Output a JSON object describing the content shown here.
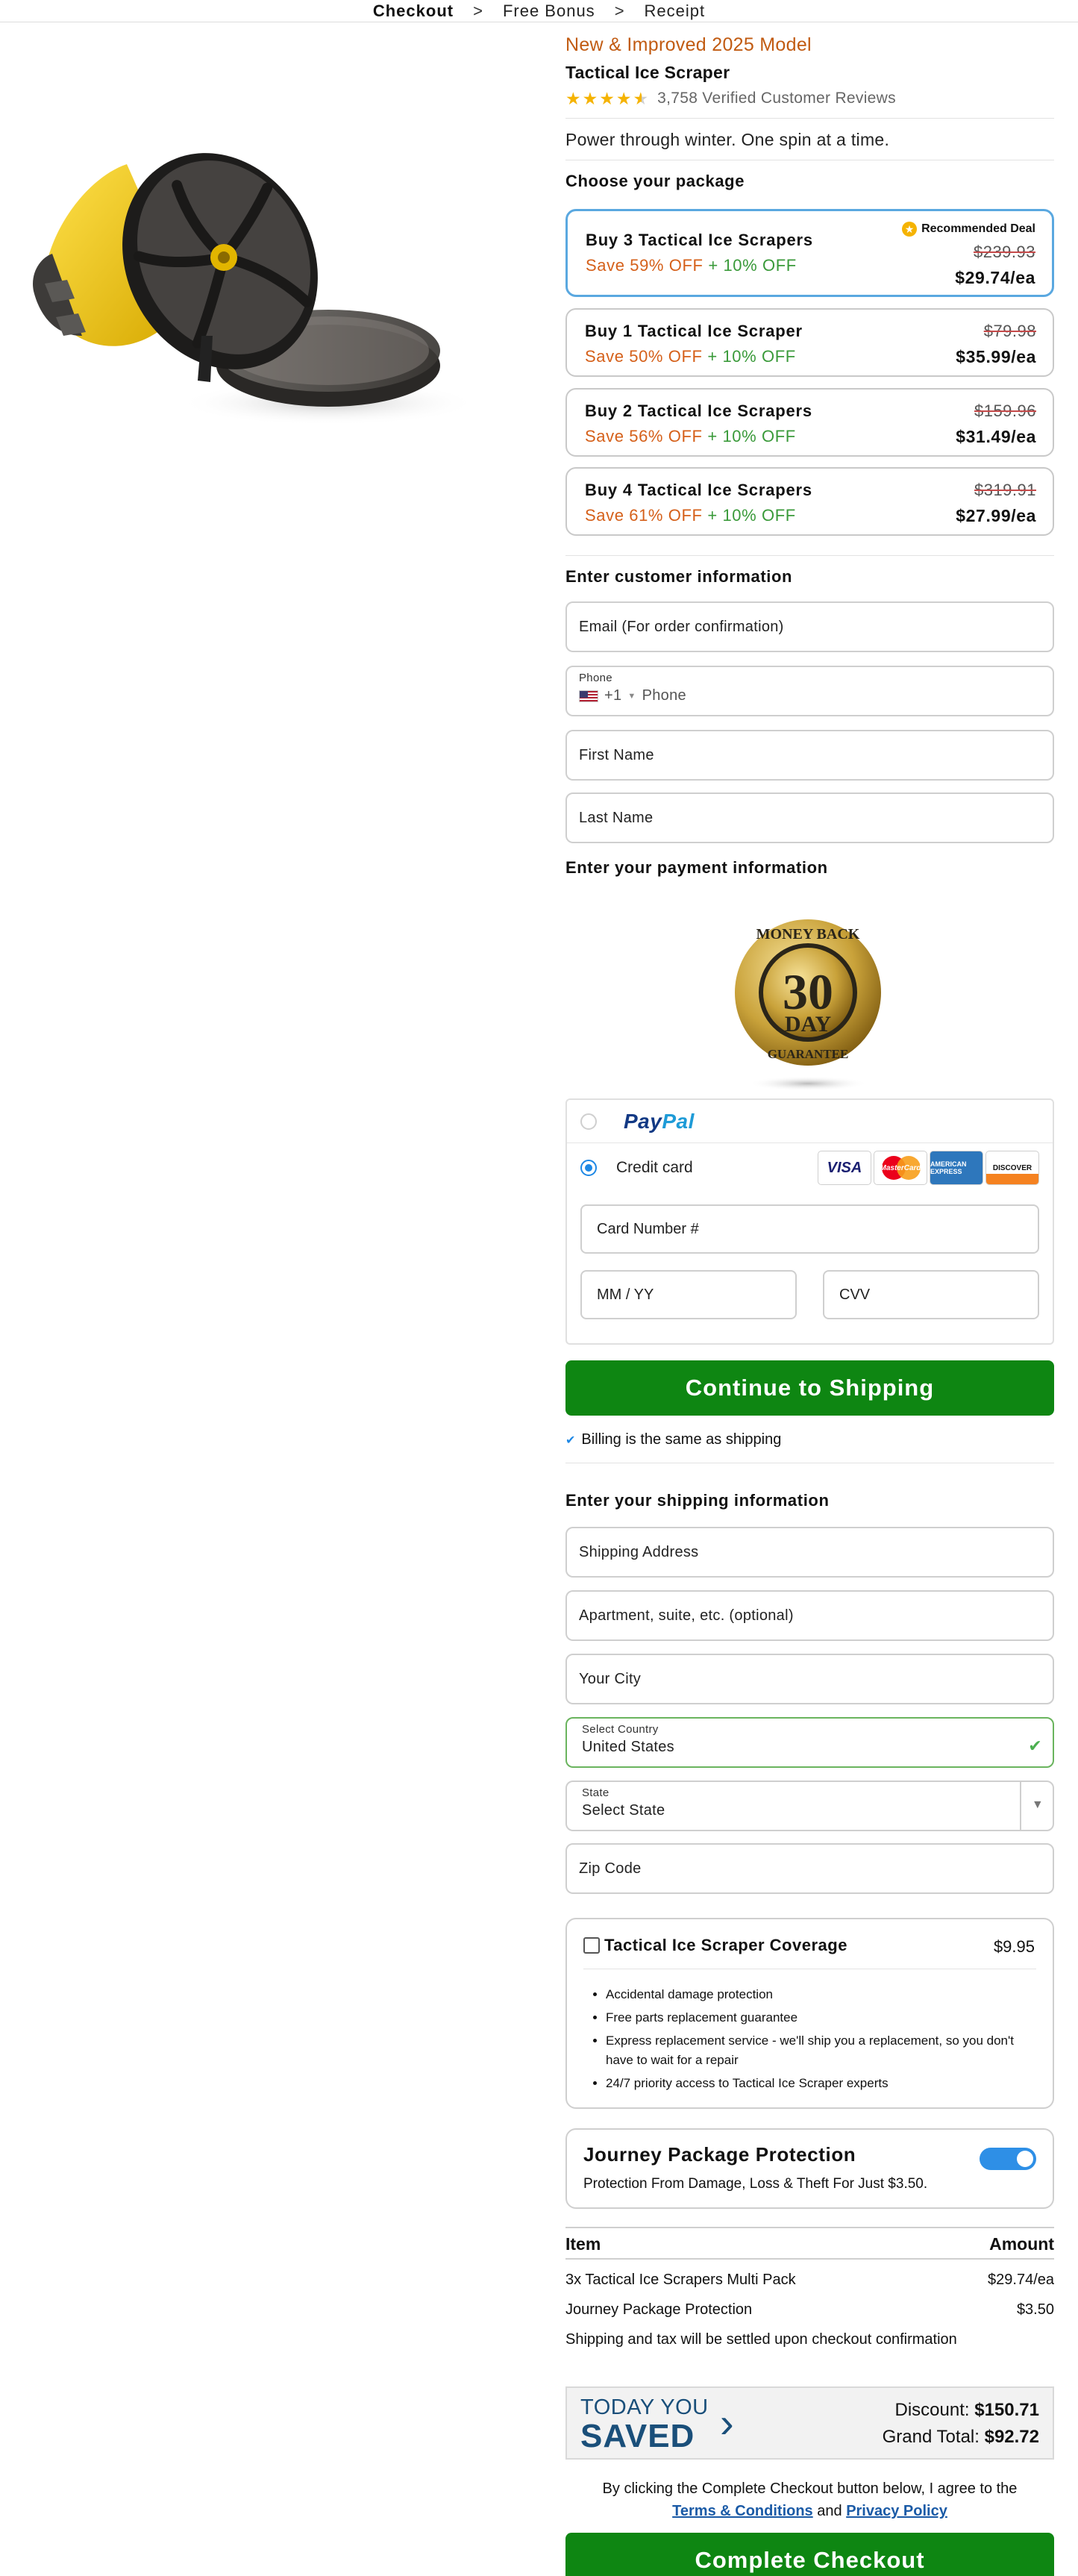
{
  "breadcrumb": [
    "Checkout",
    "Free Bonus",
    "Receipt"
  ],
  "product": {
    "model_tag": "New & Improved 2025 Model",
    "name": "Tactical Ice Scraper",
    "rating_stars": 4.5,
    "reviews": "3,758 Verified Customer Reviews",
    "tagline": "Power through winter. One spin at a time."
  },
  "package_heading": "Choose your package",
  "packages": [
    {
      "title": "Buy 3 Tactical Ice Scrapers",
      "save": "Save 59% OFF",
      "extra": "+ 10% OFF",
      "old": "$239.93",
      "new": "$29.74/ea",
      "badge": "Recommended Deal",
      "selected": true
    },
    {
      "title": "Buy 1 Tactical Ice Scraper",
      "save": "Save 50% OFF",
      "extra": "+ 10% OFF",
      "old": "$79.98",
      "new": "$35.99/ea"
    },
    {
      "title": "Buy 2 Tactical Ice Scrapers",
      "save": "Save 56% OFF",
      "extra": "+ 10% OFF",
      "old": "$159.96",
      "new": "$31.49/ea"
    },
    {
      "title": "Buy 4 Tactical Ice Scrapers",
      "save": "Save 61% OFF",
      "extra": "+ 10% OFF",
      "old": "$319.91",
      "new": "$27.99/ea"
    }
  ],
  "customer": {
    "heading": "Enter customer information",
    "email_placeholder": "Email (For order confirmation)",
    "phone_label": "Phone",
    "phone_code": "+1",
    "phone_placeholder": "Phone",
    "first_name": "First Name",
    "last_name": "Last Name"
  },
  "payment": {
    "heading": "Enter your payment information",
    "badge_text": {
      "top": "MONEY BACK",
      "number": "30",
      "day": "DAY",
      "bottom": "GUARANTEE"
    },
    "paypal_1": "Pay",
    "paypal_2": "Pal",
    "credit_label": "Credit card",
    "cards": [
      "VISA",
      "MasterCard",
      "AMERICAN EXPRESS",
      "DISCOVER"
    ],
    "card_number": "Card Number #",
    "expiry": "MM / YY",
    "cvv": "CVV"
  },
  "continue_button": "Continue to Shipping",
  "billing_same": "Billing is the same as shipping",
  "shipping": {
    "heading": "Enter your shipping information",
    "address": "Shipping Address",
    "apartment": "Apartment, suite, etc. (optional)",
    "city": "Your City",
    "country_label": "Select Country",
    "country_value": "United States",
    "state_label": "State",
    "state_value": "Select State",
    "zip": "Zip Code"
  },
  "coverage": {
    "title": "Tactical Ice Scraper Coverage",
    "price": "$9.95",
    "items": [
      "Accidental damage protection",
      "Free parts replacement guarantee",
      "Express replacement service - we'll ship you a replacement, so you don't have to wait for a repair",
      "24/7 priority access to Tactical Ice Scraper experts"
    ]
  },
  "journey": {
    "title": "Journey Package Protection",
    "subtitle": "Protection From Damage, Loss & Theft For Just $3.50.",
    "enabled": true
  },
  "summary": {
    "col_item": "Item",
    "col_amount": "Amount",
    "rows": [
      {
        "item": "3x Tactical Ice Scrapers Multi Pack",
        "amount": "$29.74/ea"
      },
      {
        "item": "Journey Package Protection",
        "amount": "$3.50"
      }
    ],
    "note": "Shipping and tax will be settled upon checkout confirmation"
  },
  "saved": {
    "today": "TODAY YOU",
    "saved": "SAVED",
    "discount_label": "Discount:",
    "discount": "$150.71",
    "total_label": "Grand Total:",
    "total": "$92.72"
  },
  "agreement": {
    "text": "By clicking the Complete Checkout button below, I agree to the",
    "terms": "Terms & Conditions",
    "and": "and",
    "privacy": "Privacy Policy"
  },
  "complete_button": "Complete Checkout",
  "colors": {
    "accent_green": "#0e8612",
    "accent_orange": "#c15b12",
    "accent_blue": "#5aa8e0"
  }
}
